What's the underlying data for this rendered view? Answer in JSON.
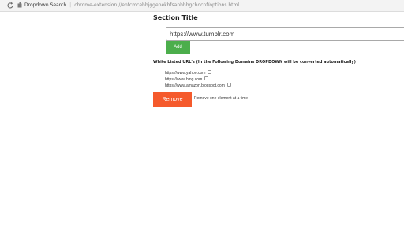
{
  "browser": {
    "site_name": "Dropdown Search",
    "separator": "|",
    "url": "chrome-extension://enfcmcehbjggepekhfsanhhhgchocnf/options.html"
  },
  "icons": {
    "reload": "reload-icon",
    "extension": "extension-icon"
  },
  "main": {
    "section_title": "Section Title",
    "url_input_value": "https://www.tumblr.com",
    "add_button_label": "Add",
    "whitelist_heading": "White Listed URL's (In the Following Domains DROPDOWN will be converted automatically)",
    "domains": [
      {
        "label": "https://www.yahoo.com"
      },
      {
        "label": "https://www.bing.com"
      },
      {
        "label": "https://www.amazon.blogspot.com"
      }
    ],
    "remove_button_label": "Remove",
    "remove_hint": "Remove one element at a time"
  },
  "colors": {
    "add_button": "#4cae4c",
    "remove_button": "#f55a2c"
  }
}
